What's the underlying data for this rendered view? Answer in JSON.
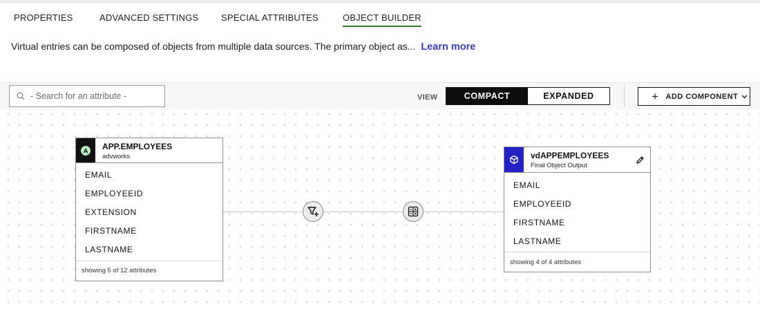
{
  "tabs": [
    "PROPERTIES",
    "ADVANCED SETTINGS",
    "SPECIAL ATTRIBUTES",
    "OBJECT BUILDER"
  ],
  "info": {
    "text": "Virtual entries can be composed of objects from multiple data sources. The primary object as...",
    "link": "Learn more"
  },
  "toolbar": {
    "search_placeholder": "- Search for an attribute -",
    "view_label": "VIEW",
    "view_options": [
      "COMPACT",
      "EXPANDED"
    ],
    "view_selected": "COMPACT",
    "add_component": "ADD COMPONENT"
  },
  "source": {
    "badge": "A",
    "title": "APP.EMPLOYEES",
    "subtitle": "advworks",
    "attributes": [
      "EMAIL",
      "EMPLOYEEID",
      "EXTENSION",
      "FIRSTNAME",
      "LASTNAME"
    ],
    "footer": "showing 5 of 12 attributes"
  },
  "output": {
    "title": "vdAPPEMPLOYEES",
    "subtitle": "Final Object Output",
    "attributes": [
      "EMAIL",
      "EMPLOYEEID",
      "FIRSTNAME",
      "LASTNAME"
    ],
    "footer": "showing 4 of 4 attributes"
  },
  "colors": {
    "active_tab_underline": "#2e7d32",
    "link": "#3b3bc4",
    "source_badge": "#111111",
    "source_badge_circle": "#b9f0c2",
    "output_badge": "#2323c4"
  },
  "icons": {
    "search": "search-icon",
    "add": "plus-icon",
    "dropdown": "chevron-down-icon",
    "filter_node": "filter-add-icon",
    "compute_node": "calculator-icon",
    "output_badge": "cube-icon",
    "edit": "pencil-icon"
  }
}
